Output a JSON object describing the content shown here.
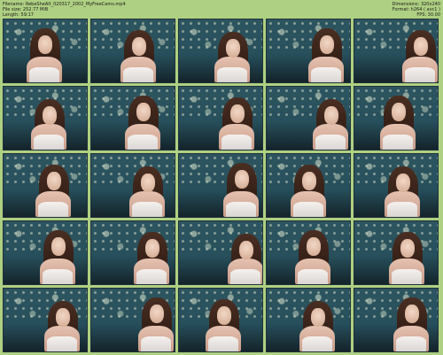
{
  "header": {
    "filename": "Filename: RebeSheAlt_020317_2002_MyFreeCams.mp4",
    "filesize": "File size: 252.77 MiB",
    "length": "Length: 59:17",
    "dimensions": "Dimensions: 320x240",
    "format": "Format: h264 ( avc1 )",
    "fps": "FPS: 30.00"
  },
  "thumbnails_count": 25,
  "colors": {
    "background": "#aed082",
    "curtain": "#2d5560",
    "frame": "#20303a"
  }
}
